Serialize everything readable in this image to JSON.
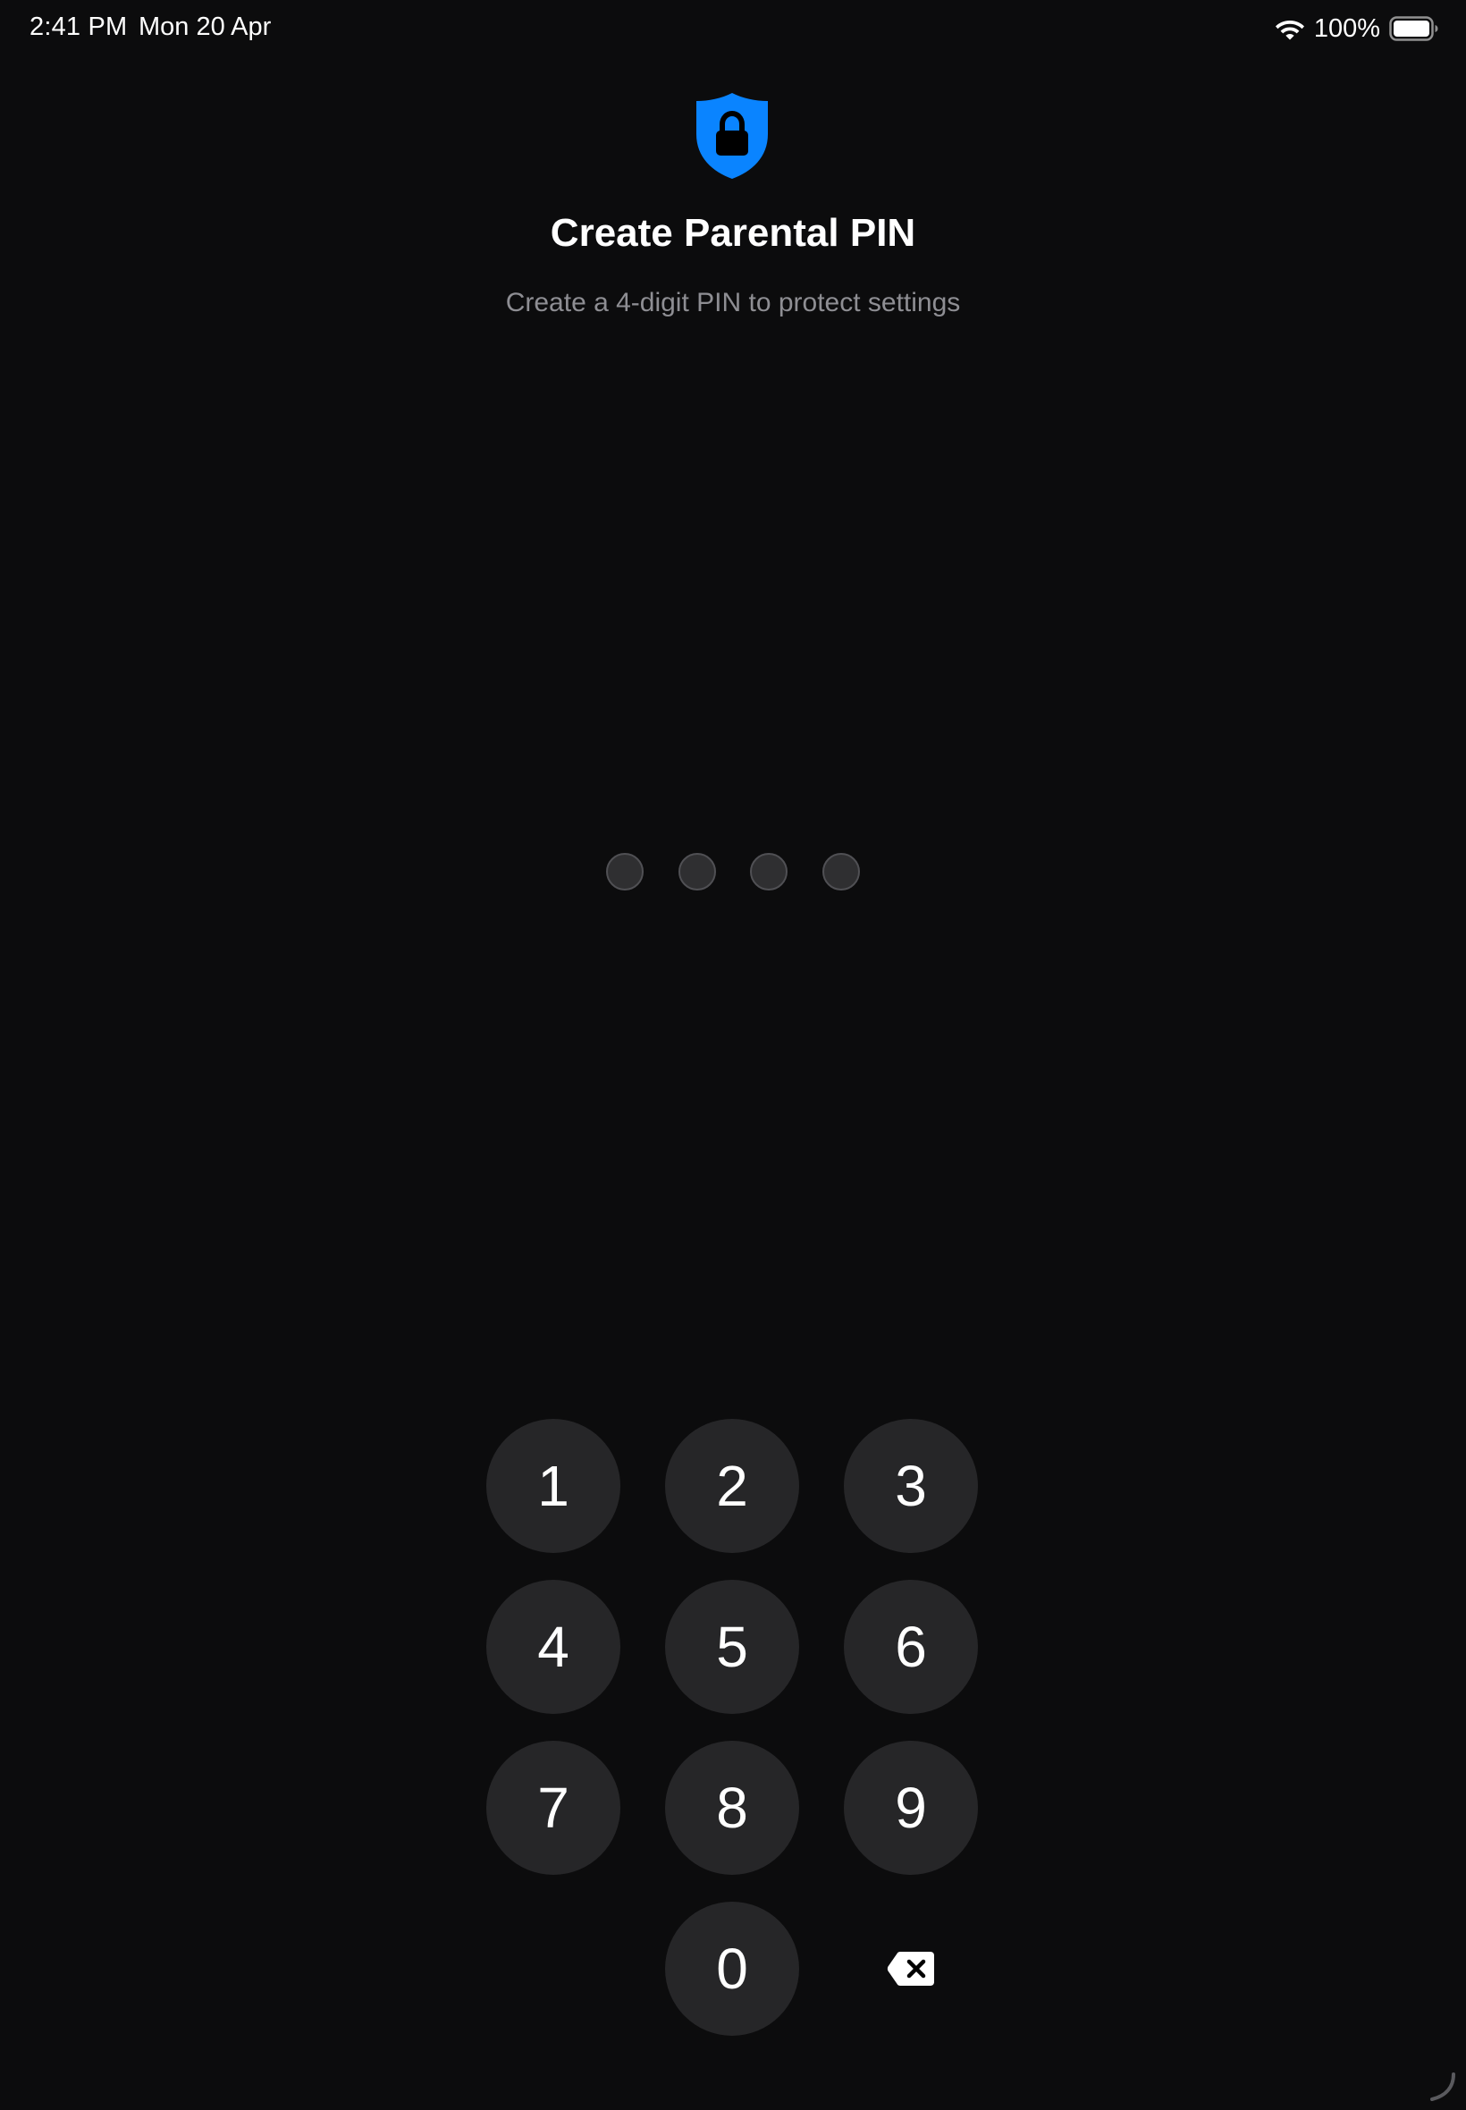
{
  "status_bar": {
    "time": "2:41 PM",
    "date": "Mon 20 Apr",
    "battery_percent": "100%",
    "battery_level": 1.0,
    "wifi_icon": "wifi-icon",
    "battery_icon": "battery-icon"
  },
  "header": {
    "icon": "shield-lock-icon",
    "icon_color": "#0a84ff",
    "title": "Create Parental PIN",
    "subtitle": "Create a 4-digit PIN to protect settings"
  },
  "pin": {
    "length": 4,
    "entered": 0
  },
  "keypad": {
    "keys": [
      "1",
      "2",
      "3",
      "4",
      "5",
      "6",
      "7",
      "8",
      "9",
      "0"
    ],
    "delete_icon": "backspace-icon"
  },
  "colors": {
    "background": "#0c0c0d",
    "key_background": "#262628",
    "accent": "#0a84ff",
    "subtitle": "#8e8e93"
  }
}
